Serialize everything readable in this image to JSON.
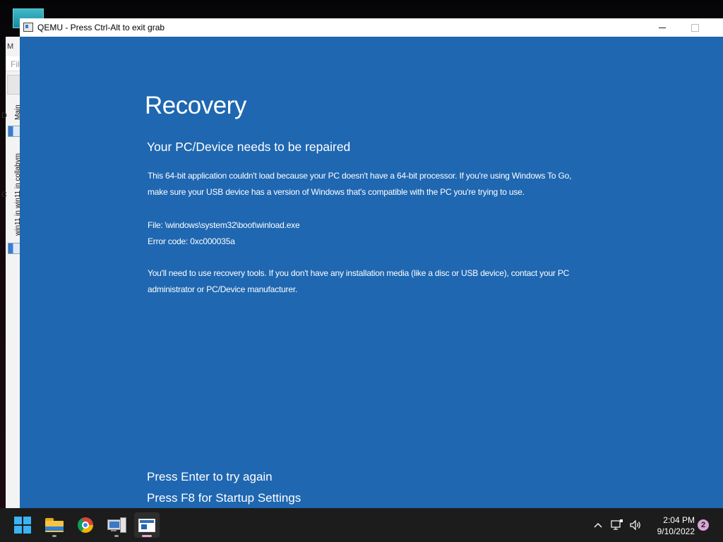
{
  "window": {
    "title": "QEMU - Press Ctrl-Alt to exit grab",
    "icon": "qemu-window-icon"
  },
  "background_window": {
    "letters": [
      "M",
      "Fil",
      "D",
      "C"
    ],
    "tabs": [
      "Main",
      "win11 in win11 in collabvm"
    ]
  },
  "recovery": {
    "heading": "Recovery",
    "subheading": "Your PC/Device needs to be repaired",
    "message": "This 64-bit application couldn't load because your PC doesn't have a 64-bit processor. If you're using Windows To Go, make sure your USB device has a version of Windows that's compatible with the PC you're trying to use.",
    "file": "File: \\windows\\system32\\boot\\winload.exe",
    "error_code": "Error code: 0xc000035a",
    "guidance": "You'll need to use recovery tools. If you don't have any installation media (like a disc or USB device), contact your PC administrator or PC/Device manufacturer.",
    "action_enter": "Press Enter to try again",
    "action_f8": "Press F8 for Startup Settings",
    "background_color": "#1f67b1"
  },
  "taskbar": {
    "apps": [
      {
        "name": "start",
        "icon": "windows-start-icon"
      },
      {
        "name": "file-explorer",
        "icon": "folder-icon"
      },
      {
        "name": "chrome",
        "icon": "chrome-icon"
      },
      {
        "name": "vm-manager",
        "icon": "computer-icon"
      },
      {
        "name": "qemu",
        "icon": "qemu-window-icon",
        "active": true
      }
    ],
    "tray": {
      "time": "2:04 PM",
      "date": "9/10/2022",
      "notification_count": "2"
    }
  }
}
